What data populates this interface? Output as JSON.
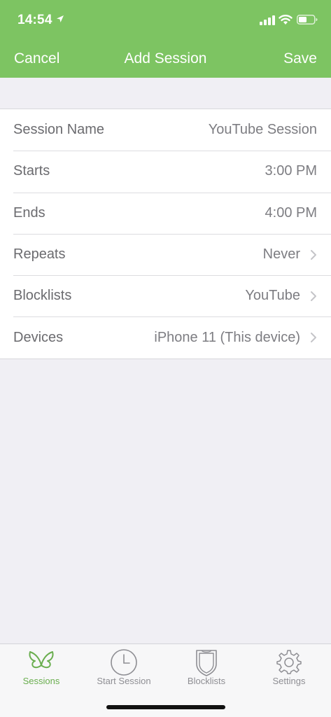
{
  "status": {
    "time": "14:54"
  },
  "nav": {
    "cancel": "Cancel",
    "title": "Add Session",
    "save": "Save"
  },
  "form": {
    "rows": [
      {
        "label": "Session Name",
        "value": "YouTube  Session"
      },
      {
        "label": "Starts",
        "value": "3:00 PM"
      },
      {
        "label": "Ends",
        "value": "4:00 PM"
      },
      {
        "label": "Repeats",
        "value": "Never"
      },
      {
        "label": "Blocklists",
        "value": "YouTube"
      },
      {
        "label": "Devices",
        "value": "iPhone 11 (This device)"
      }
    ]
  },
  "tabs": [
    {
      "label": "Sessions",
      "icon": "butterfly-icon",
      "active": true
    },
    {
      "label": "Start Session",
      "icon": "clock-icon",
      "active": false
    },
    {
      "label": "Blocklists",
      "icon": "shield-icon",
      "active": false
    },
    {
      "label": "Settings",
      "icon": "gear-icon",
      "active": false
    }
  ],
  "colors": {
    "accent": "#7dc462",
    "active_tab": "#6aae4f",
    "background": "#f0eff4"
  }
}
